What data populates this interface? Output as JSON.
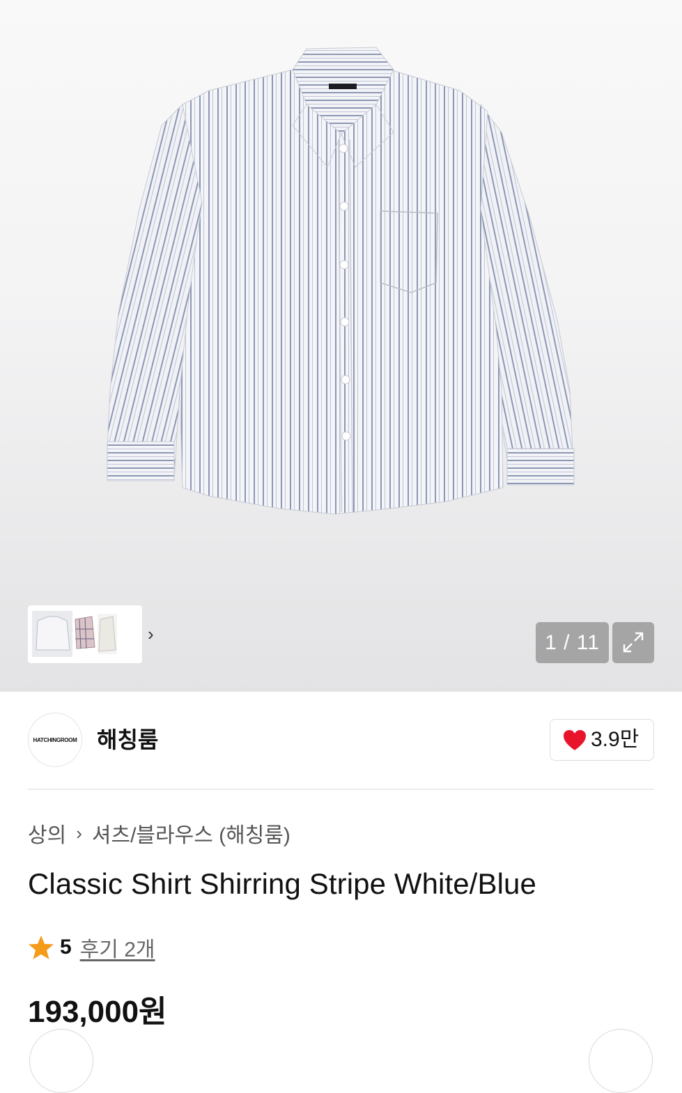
{
  "gallery": {
    "counter": "1 / 11",
    "thumb_arrow": "›",
    "expand_icon": "expand-icon",
    "background_color": "#ececee"
  },
  "brand": {
    "logo_text": "HATCHINGROOM",
    "name": "해칭룸",
    "like_count": "3.9만",
    "heart_color": "#e8142c"
  },
  "breadcrumb": {
    "items": [
      "상의",
      "셔츠/블라우스 (해칭룸)"
    ]
  },
  "product": {
    "title": "Classic Shirt Shirring Stripe White/Blue",
    "rating": "5",
    "review_link": "후기 2개",
    "star_color": "#f59b1c",
    "price": "193,000원"
  }
}
